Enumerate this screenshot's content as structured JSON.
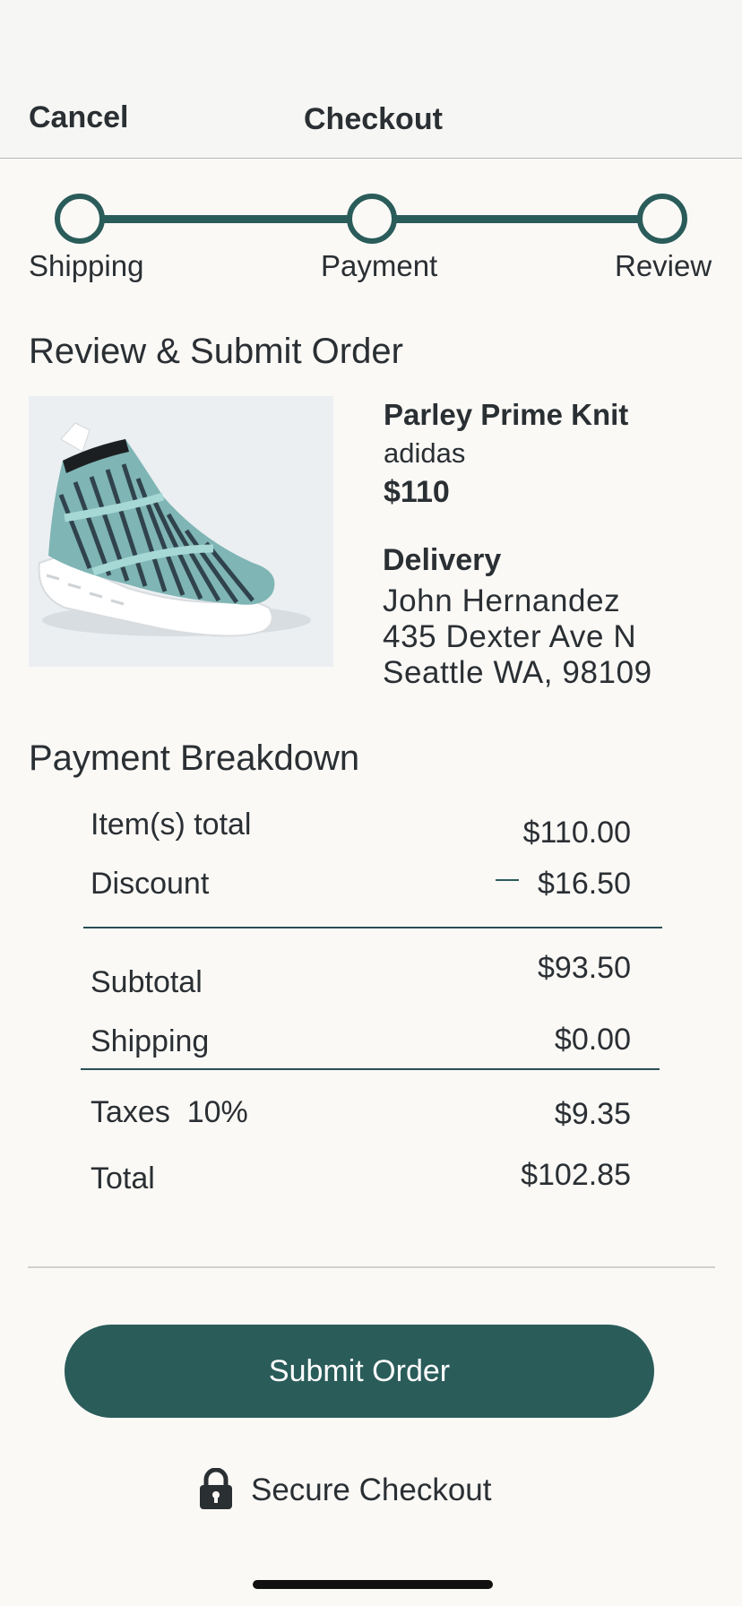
{
  "header": {
    "cancel_label": "Cancel",
    "title": "Checkout"
  },
  "stepper": {
    "steps": [
      {
        "label": "Shipping"
      },
      {
        "label": "Payment"
      },
      {
        "label": "Review"
      }
    ]
  },
  "review": {
    "section_title": "Review & Submit Order",
    "product": {
      "name": "Parley Prime Knit",
      "brand": "adidas",
      "price": "$110"
    },
    "delivery": {
      "label": "Delivery",
      "name": "John Hernandez",
      "street": "435 Dexter Ave N",
      "city_line": "Seattle WA, 98109"
    }
  },
  "breakdown": {
    "section_title": "Payment Breakdown",
    "items_total": {
      "label": "Item(s) total",
      "value": "$110.00"
    },
    "discount": {
      "label": "Discount",
      "value": "$16.50"
    },
    "subtotal": {
      "label": "Subtotal",
      "value": "$93.50"
    },
    "shipping": {
      "label": "Shipping",
      "value": "$0.00"
    },
    "taxes": {
      "label": "Taxes  10%",
      "value": "$9.35"
    },
    "total": {
      "label": "Total",
      "value": "$102.85"
    }
  },
  "actions": {
    "submit_label": "Submit Order",
    "secure_label": "Secure Checkout"
  },
  "colors": {
    "accent": "#2a5c5a",
    "background": "#faf9f6",
    "header_background": "#f6f6f4",
    "text": "#2a2f33"
  },
  "icons": {
    "secure": "lock-icon",
    "product": "sneaker-image"
  }
}
